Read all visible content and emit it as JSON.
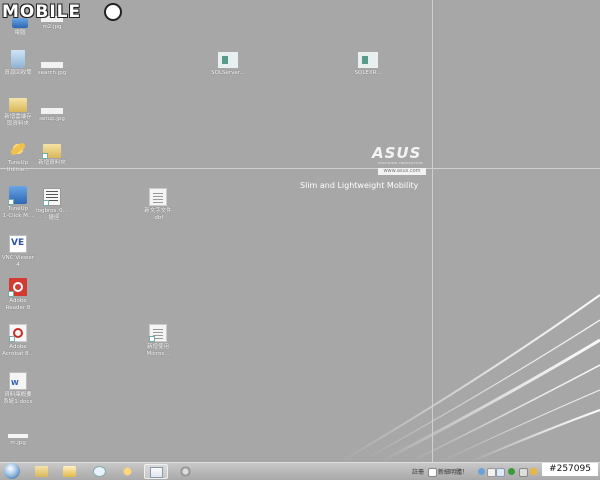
{
  "watermark": {
    "text": "MOBILE",
    "badge_text": "#257095"
  },
  "desktop_icons": [
    {
      "id": "computer",
      "label": "電腦"
    },
    {
      "id": "m2",
      "label": "m2.jpg"
    },
    {
      "id": "recycle",
      "label": "資源回收筒"
    },
    {
      "id": "search",
      "label": "search.jpg"
    },
    {
      "id": "newfolder",
      "label": "新增雲端存\n取資料夾"
    },
    {
      "id": "setup",
      "label": "setup.jpg"
    },
    {
      "id": "tuneup-util",
      "label": "TuneUp\nUtilitie..."
    },
    {
      "id": "newdoc-folder",
      "label": "新增資料夾"
    },
    {
      "id": "tuneup-click",
      "label": "TuneUp\n1-Click M..."
    },
    {
      "id": "logbros",
      "label": "logbros_0...\n- 捷徑"
    },
    {
      "id": "newtext",
      "label": "新文字文件\n.dbf"
    },
    {
      "id": "vnc",
      "label": "VNC Viewer\n4"
    },
    {
      "id": "adobe-reader",
      "label": "Adobe\nReader 8"
    },
    {
      "id": "adobe-acrobat",
      "label": "Adobe\nAcrobat 8..."
    },
    {
      "id": "newfile2",
      "label": "新增使用\nMicros..."
    },
    {
      "id": "worddoc",
      "label": "資料庫概要\n系統1.docx"
    },
    {
      "id": "mjpg",
      "label": "m.jpg"
    },
    {
      "id": "sqlserver1",
      "label": "SQLServer..."
    },
    {
      "id": "sqlserver2",
      "label": "SQLEXR..."
    }
  ],
  "brand": {
    "logo": "ASUS",
    "logo_sub": "INSPIRING INNOVATION",
    "url": "www.asus.com",
    "tagline": "Slim and Lightweight Mobility"
  },
  "taskbar": {
    "tray_input_label": "註冊",
    "tray_app_label": "新細明體！",
    "apps": [
      "windows-explorer",
      "media-player",
      "control-panel",
      "tuneup",
      "word-document",
      "settings"
    ]
  },
  "colors": {
    "desktop_bg": "#a7a7a7",
    "taskbar_bg": "#b9b9b9",
    "accent_red": "#d33b32",
    "accent_blue": "#2d52a8"
  }
}
